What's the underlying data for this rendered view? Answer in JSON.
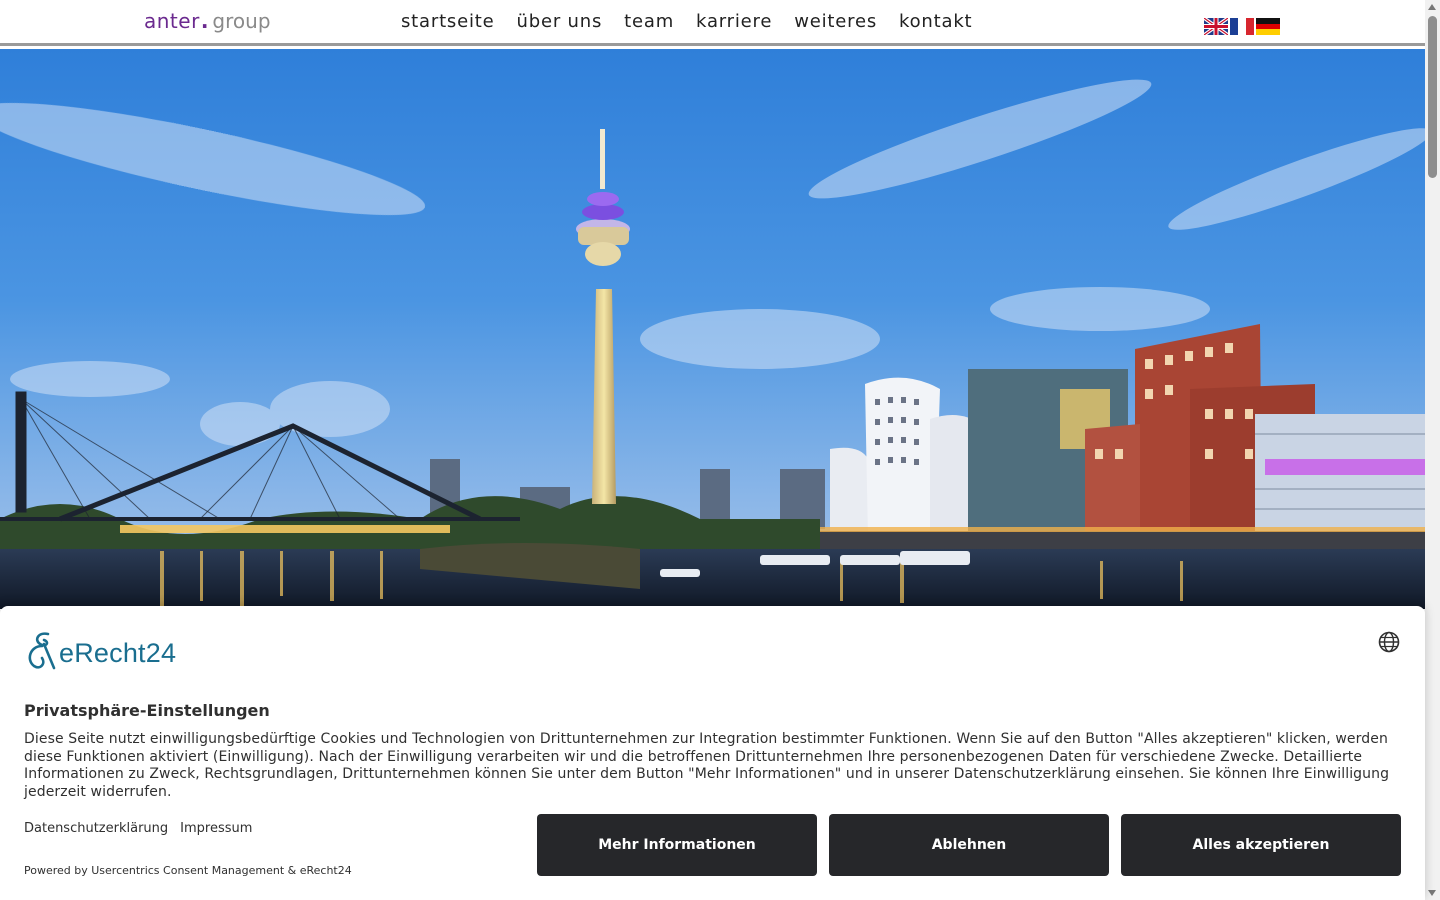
{
  "header": {
    "logo": {
      "part1": "anter",
      "dot": ".",
      "part2": "group"
    },
    "nav": [
      "startseite",
      "über uns",
      "team",
      "karriere",
      "weiteres",
      "kontakt"
    ],
    "flags": [
      "uk-flag-icon",
      "france-flag-icon",
      "germany-flag-icon"
    ]
  },
  "hero": {
    "image": "duesseldorf-skyline-rheinturm-medienhafen"
  },
  "consent": {
    "brand": "eRecht24",
    "title": "Privatsphäre-Einstellungen",
    "text": "Diese Seite nutzt einwilligungsbedürftige Cookies und Technologien von Drittunternehmen zur Integration bestimmter Funktionen. Wenn Sie auf den Button \"Alles akzeptieren\" klicken, werden diese Funktionen aktiviert (Einwilligung). Nach der Einwilligung verarbeiten wir und die betroffenen Drittunternehmen Ihre personenbezogenen Daten für verschiedene Zwecke. Detaillierte Informationen zu Zweck, Rechtsgrundlagen, Drittunternehmen können Sie unter dem Button \"Mehr Informationen\" und in unserer Datenschutzerklärung einsehen. Sie können Ihre Einwilligung jederzeit widerrufen.",
    "links": {
      "privacy": "Datenschutzerklärung",
      "imprint": "Impressum"
    },
    "powered": "Powered by Usercentrics Consent Management & eRecht24",
    "buttons": {
      "more": "Mehr Informationen",
      "deny": "Ablehnen",
      "accept": "Alles akzeptieren"
    },
    "colors": {
      "button_bg": "#26272a",
      "brand": "#1a6e8f"
    }
  }
}
